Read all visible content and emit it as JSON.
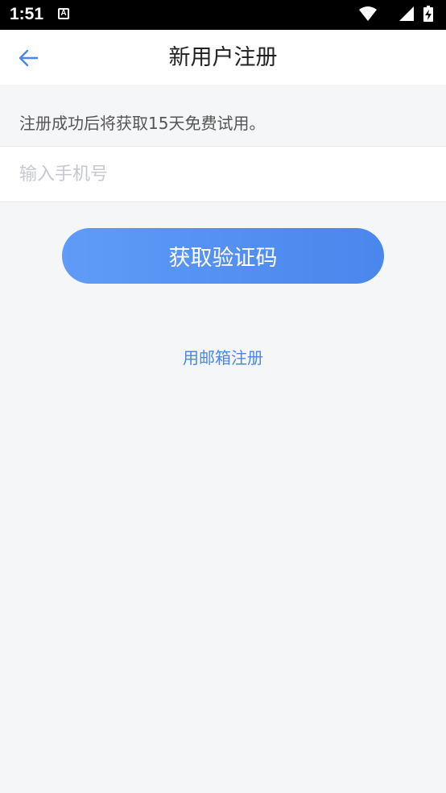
{
  "status_bar": {
    "time": "1:51",
    "a_icon_glyph": "A",
    "icons": [
      "wifi-icon",
      "signal-icon",
      "battery-charging-icon"
    ]
  },
  "header": {
    "back_icon": "arrow-left-icon",
    "title": "新用户注册"
  },
  "main": {
    "notice": "注册成功后将获取15天免费试用。",
    "phone_input": {
      "placeholder": "输入手机号",
      "value": ""
    },
    "get_code_button": "获取验证码",
    "email_register_link": "用邮箱注册"
  },
  "colors": {
    "accent": "#4a86ec",
    "background": "#f5f6f8",
    "title": "#222222"
  }
}
